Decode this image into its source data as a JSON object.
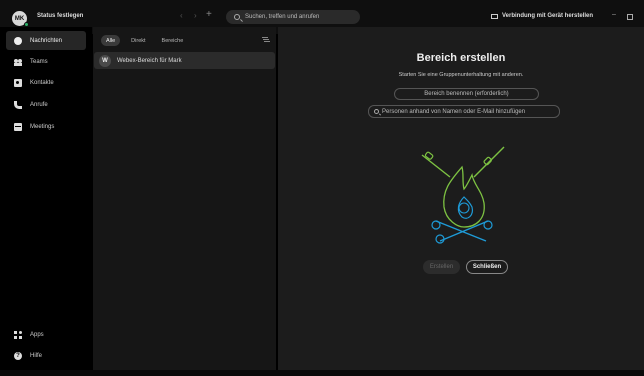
{
  "topbar": {
    "avatar_initials": "MK",
    "status_label": "Status festlegen",
    "nav_back": "‹",
    "nav_forward": "›",
    "nav_add": "+",
    "search_placeholder": "Suchen, treffen und anrufen",
    "connect_device_label": "Verbindung mit Gerät herstellen",
    "minimize": "–"
  },
  "sidebar": {
    "items": [
      {
        "label": "Nachrichten",
        "icon": "chat-icon",
        "active": true
      },
      {
        "label": "Teams",
        "icon": "teams-icon"
      },
      {
        "label": "Kontakte",
        "icon": "contacts-icon"
      },
      {
        "label": "Anrufe",
        "icon": "phone-icon"
      },
      {
        "label": "Meetings",
        "icon": "calendar-icon"
      }
    ],
    "bottom_items": [
      {
        "label": "Apps",
        "icon": "apps-icon"
      },
      {
        "label": "Hilfe",
        "icon": "help-icon"
      }
    ]
  },
  "list_panel": {
    "filters": [
      {
        "label": "Alle",
        "active": true
      },
      {
        "label": "Direkt"
      },
      {
        "label": "Bereiche"
      }
    ],
    "spaces": [
      {
        "initial": "W",
        "name": "Webex-Bereich für Mark"
      }
    ]
  },
  "create_space": {
    "title": "Bereich erstellen",
    "subtitle": "Starten Sie eine Gruppenunterhaltung mit anderen.",
    "name_placeholder": "Bereich benennen (erforderlich)",
    "people_placeholder": "Personen anhand von Namen oder E-Mail hinzufügen",
    "create_label": "Erstellen",
    "close_label": "Schließen"
  },
  "colors": {
    "presence_green": "#2fb36b",
    "illustration_green": "#7dc242",
    "illustration_blue": "#1e9bd7"
  }
}
